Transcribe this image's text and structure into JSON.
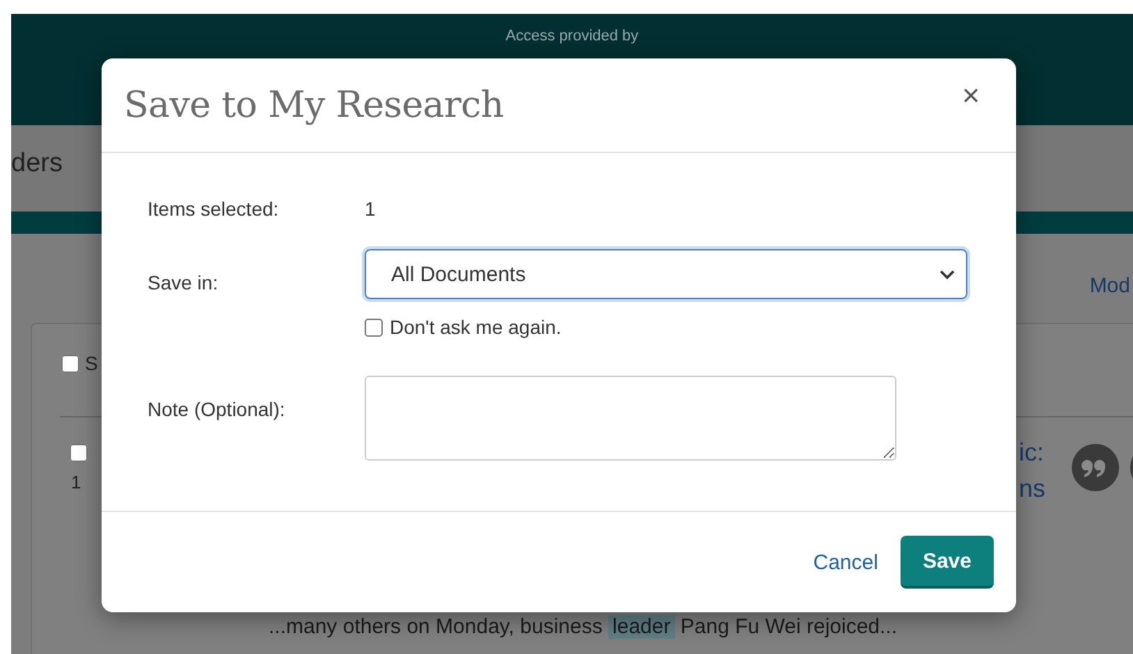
{
  "header": {
    "access_text": "Access provided by"
  },
  "nav": {
    "label": "ders"
  },
  "page": {
    "link": "Mod",
    "select_all": {
      "label": "S",
      "checked": false
    },
    "result": {
      "checked": false,
      "number": "1",
      "title_lines": [
        "ic:",
        "ns"
      ]
    },
    "snippet_lines": [
      [
        {
          "text": "...many others on Monday, business ",
          "highlighted": false
        },
        {
          "text": "leader",
          "highlighted": true
        },
        {
          "text": " Pang Fu Wei rejoiced...",
          "highlighted": false
        }
      ]
    ]
  },
  "dialog": {
    "title": "Save to My Research",
    "close": "×",
    "fields": [
      {
        "kind": "text",
        "label": "Items selected:",
        "value": "1"
      },
      {
        "kind": "select",
        "label": "Save in:",
        "value": "All Documents",
        "option": {
          "label": "Don't ask me again.",
          "checked": false
        }
      },
      {
        "kind": "textarea",
        "label": "Note (Optional):"
      }
    ],
    "buttons": [
      {
        "kind": "link",
        "label": "Cancel"
      },
      {
        "kind": "primary",
        "label": "Save"
      }
    ]
  }
}
